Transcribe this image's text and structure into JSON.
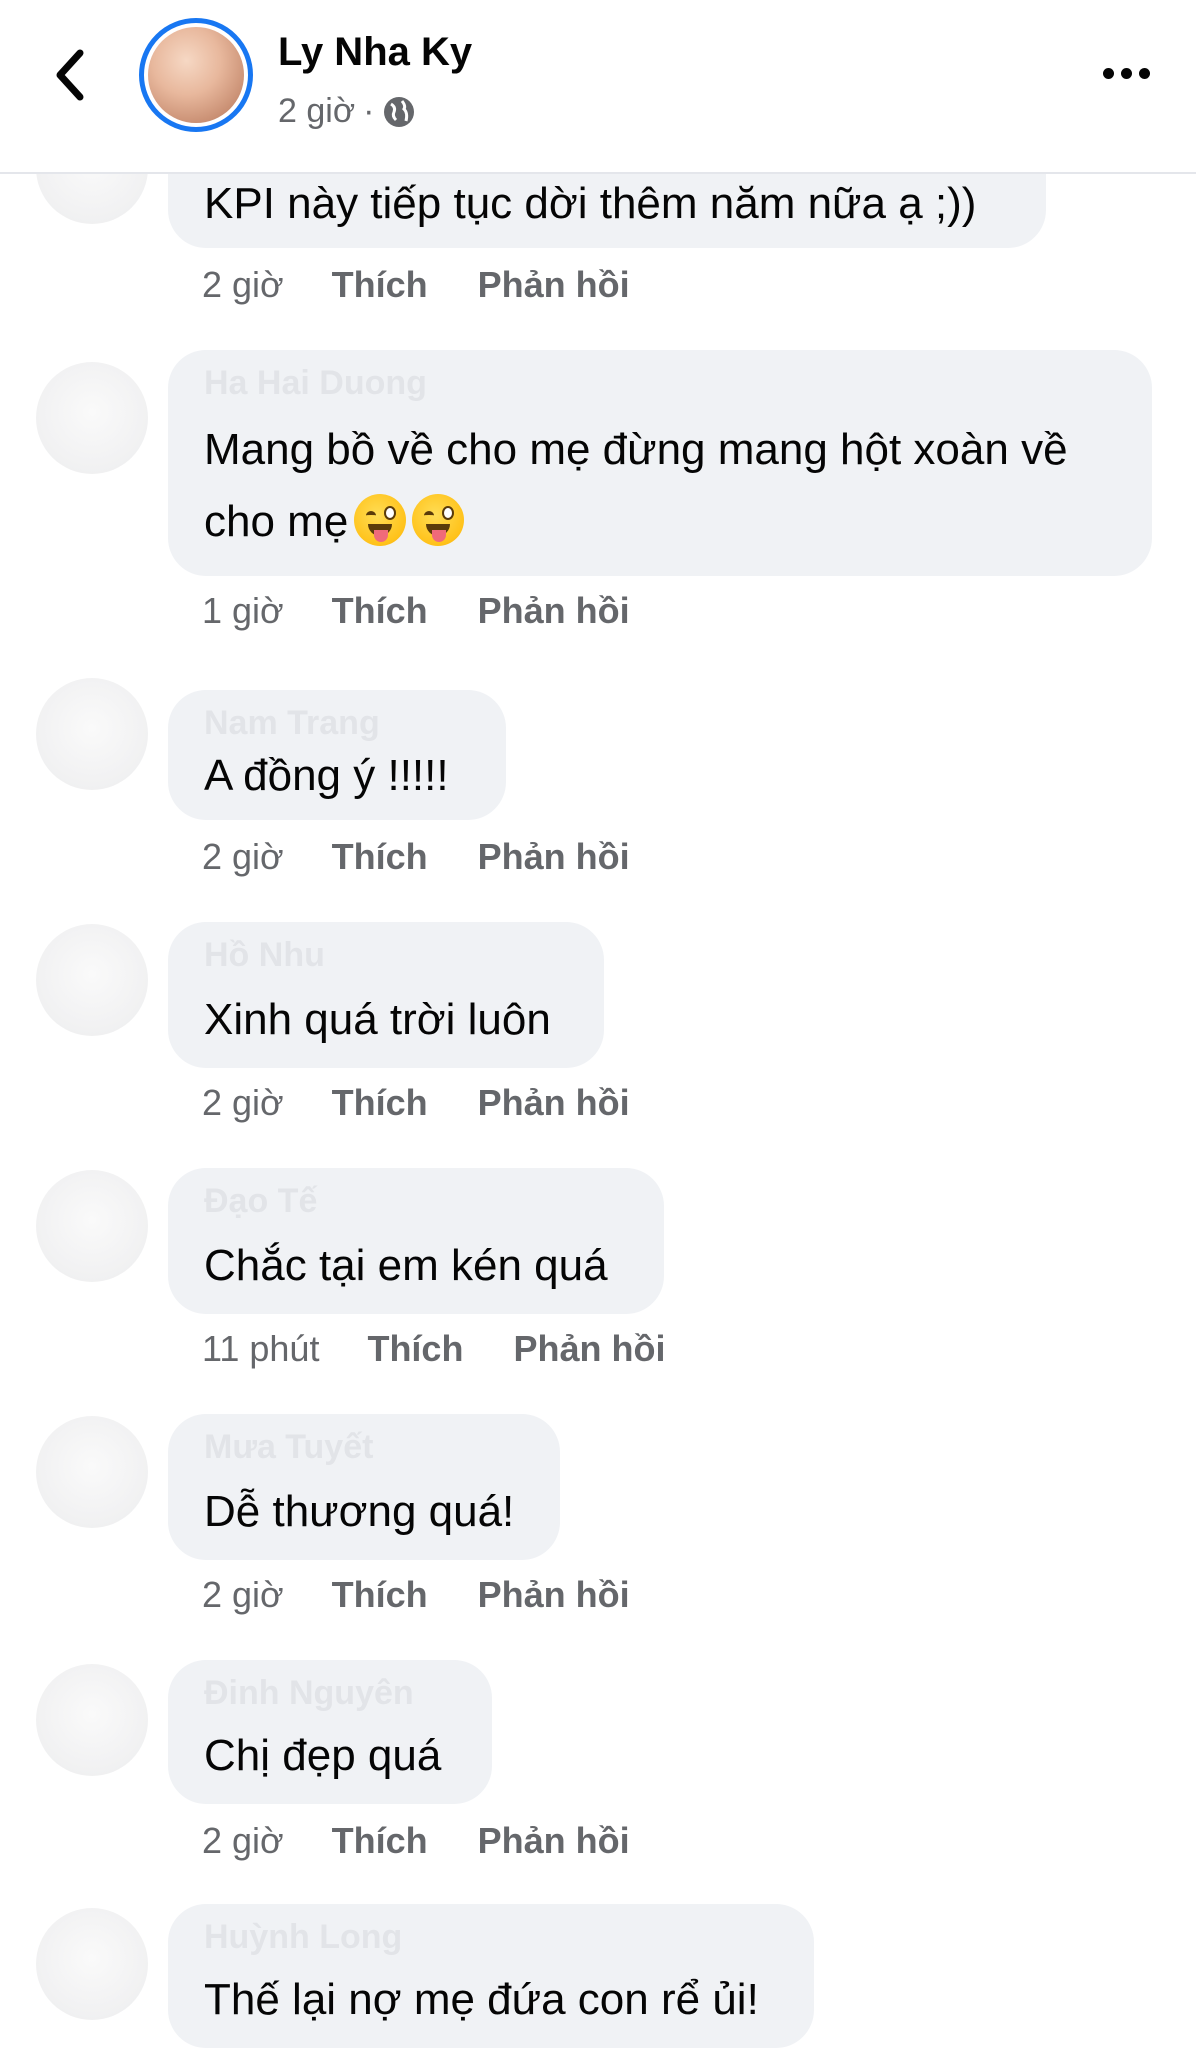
{
  "header": {
    "name": "Ly Nha Ky",
    "time": "2 giờ",
    "separator": "·",
    "icons": {
      "back": "chevron-left-icon",
      "privacy": "globe-icon",
      "more": "more-horizontal-icon"
    }
  },
  "labels": {
    "like": "Thích",
    "reply": "Phản hồi"
  },
  "comments": [
    {
      "name": "",
      "text_lines": [
        "KPI này tiếp tục dời thêm năm nữa ạ ;))"
      ],
      "time": "2 giờ"
    },
    {
      "name": "Ha Hai Duong",
      "text_lines": [
        "Mang bồ về cho mẹ đừng mang hột xoàn về",
        "cho mẹ"
      ],
      "emoji": [
        "zany-face",
        "zany-face"
      ],
      "time": "1 giờ"
    },
    {
      "name": "Nam Trang",
      "text_lines": [
        "A đồng ý !!!!!"
      ],
      "time": "2 giờ"
    },
    {
      "name": "Hồ Nhu",
      "text_lines": [
        "Xinh quá trời luôn"
      ],
      "time": "2 giờ"
    },
    {
      "name": "Đạo Tế",
      "text_lines": [
        "Chắc tại em kén quá"
      ],
      "time": "11 phút"
    },
    {
      "name": "Mưa Tuyết",
      "text_lines": [
        "Dễ thương quá!"
      ],
      "time": "2 giờ"
    },
    {
      "name": "Đinh Nguyên",
      "text_lines": [
        "Chị đẹp quá"
      ],
      "time": "2 giờ"
    },
    {
      "name": "Huỳnh Long",
      "text_lines": [
        "Thế lại nợ mẹ đứa con rể ủi!"
      ],
      "time": ""
    }
  ]
}
